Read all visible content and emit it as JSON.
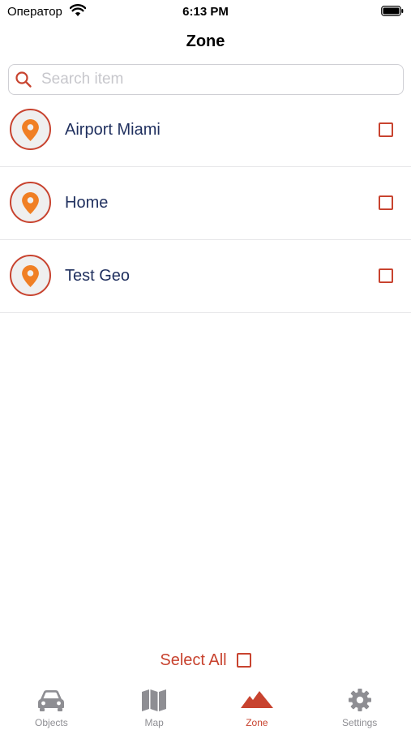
{
  "status_bar": {
    "carrier": "Оператор",
    "time": "6:13 PM"
  },
  "nav": {
    "title": "Zone"
  },
  "search": {
    "placeholder": "Search item",
    "value": ""
  },
  "zones": [
    {
      "name": "Airport Miami",
      "checked": false
    },
    {
      "name": "Home",
      "checked": false
    },
    {
      "name": "Test Geo",
      "checked": false
    }
  ],
  "select_all": {
    "label": "Select All",
    "checked": false
  },
  "tabs": [
    {
      "label": "Objects",
      "icon": "car-icon",
      "active": false
    },
    {
      "label": "Map",
      "icon": "map-icon",
      "active": false
    },
    {
      "label": "Zone",
      "icon": "mountains-icon",
      "active": true
    },
    {
      "label": "Settings",
      "icon": "gear-icon",
      "active": false
    }
  ],
  "colors": {
    "accent": "#c8432f",
    "pin": "#f07f24",
    "item_text": "#1f2f5e",
    "inactive_tab": "#8e8e93"
  }
}
